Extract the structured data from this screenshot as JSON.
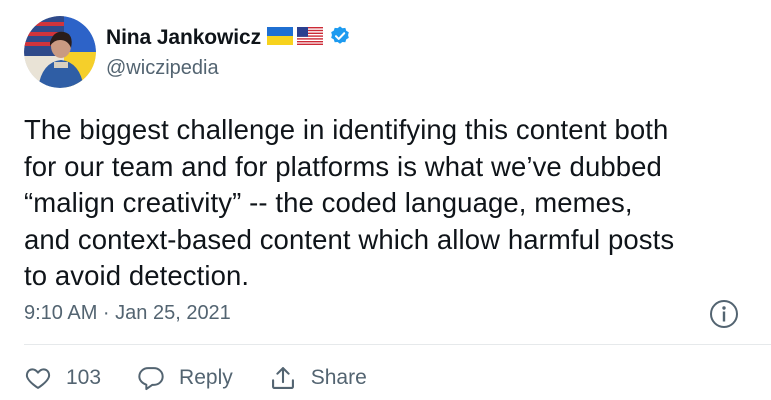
{
  "author": {
    "name": "Nina Jankowicz",
    "handle": "@wiczipedia",
    "flags": [
      "ukraine-flag-icon",
      "us-flag-icon"
    ],
    "verified_icon": "verified-badge-icon"
  },
  "tweet": {
    "lines": [
      "The biggest challenge in identifying this content both",
      "for our team and for platforms is what we’ve dubbed",
      "“malign creativity” -- the coded language, memes,",
      "and context-based content which allow harmful posts",
      "to avoid detection."
    ],
    "timestamp": "9:10 AM · Jan 25, 2021"
  },
  "actions": {
    "like_count": "103",
    "reply_label": "Reply",
    "share_label": "Share"
  },
  "colors": {
    "verified": "#1d9bf0",
    "text": "#0f1419",
    "muted": "#536471"
  }
}
